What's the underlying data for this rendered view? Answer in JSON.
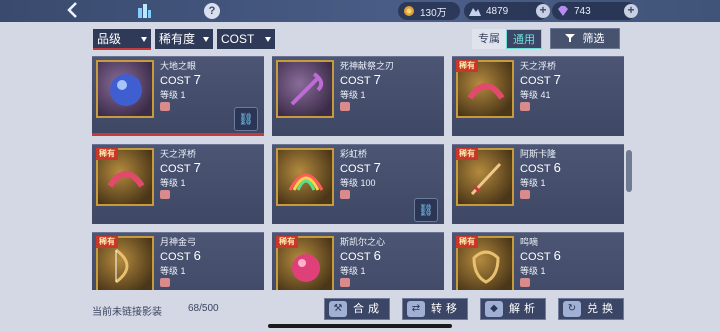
{
  "topbar": {
    "back_icon": "chevron-left-icon",
    "help_label": "?",
    "currencies": [
      {
        "icon": "coin-icon",
        "value": "130万"
      },
      {
        "icon": "stamina-icon",
        "value": "4879"
      },
      {
        "icon": "diamond-icon",
        "value": "743"
      }
    ]
  },
  "filters": {
    "sort1": "品级",
    "sort2": "稀有度",
    "sort3": "COST",
    "tab_exclusive": "专属",
    "tab_general": "通用",
    "filter_label": "筛选"
  },
  "cards": [
    {
      "name": "大地之眼",
      "cost_label": "COST",
      "cost": "7",
      "level": "等级 1",
      "rare": false,
      "link": true
    },
    {
      "name": "死神献祭之刃",
      "cost_label": "COST",
      "cost": "7",
      "level": "等级 1",
      "rare": false,
      "link": false
    },
    {
      "name": "天之浮桥",
      "cost_label": "COST",
      "cost": "7",
      "level": "等级 41",
      "rare": true,
      "link": false
    },
    {
      "name": "天之浮桥",
      "cost_label": "COST",
      "cost": "7",
      "level": "等级 1",
      "rare": true,
      "link": false
    },
    {
      "name": "彩虹桥",
      "cost_label": "COST",
      "cost": "7",
      "level": "等级 100",
      "rare": false,
      "link": true
    },
    {
      "name": "阿斯卡隆",
      "cost_label": "COST",
      "cost": "6",
      "level": "等级 1",
      "rare": true,
      "link": false
    },
    {
      "name": "月神金弓",
      "cost_label": "COST",
      "cost": "6",
      "level": "等级 1",
      "rare": true,
      "link": false
    },
    {
      "name": "斯凯尔之心",
      "cost_label": "COST",
      "cost": "6",
      "level": "等级 1",
      "rare": true,
      "link": false
    },
    {
      "name": "鸣嘀",
      "cost_label": "COST",
      "cost": "6",
      "level": "等级 1",
      "rare": true,
      "link": false
    }
  ],
  "rare_badge": "稀有",
  "bottom": {
    "label": "当前未链接影装",
    "count": "68/500",
    "actions": [
      "合成",
      "转移",
      "解析",
      "兑换"
    ]
  },
  "colors": {
    "accent": "#c33b3b",
    "panel": "#3e4865",
    "active_tab": "#6fe0d8"
  }
}
